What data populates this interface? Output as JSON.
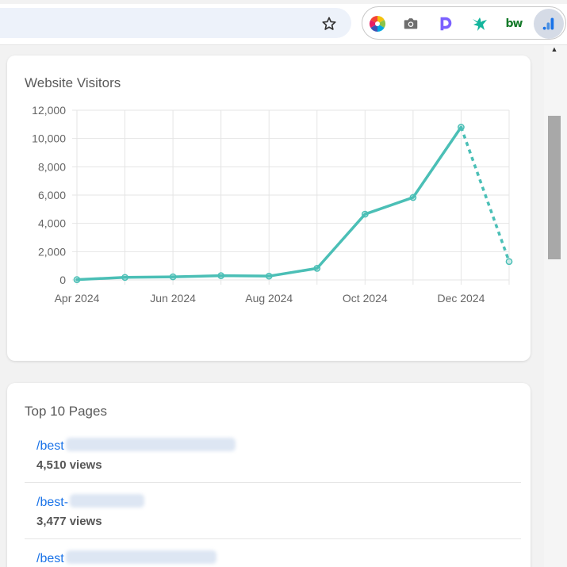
{
  "browser": {
    "extensions": [
      {
        "name": "color-wheel-icon"
      },
      {
        "name": "camera-icon"
      },
      {
        "name": "d-extension-icon"
      },
      {
        "name": "bird-extension-icon"
      },
      {
        "name": "bw-extension-icon",
        "label": "bw"
      },
      {
        "name": "analytics-extension-icon"
      }
    ]
  },
  "visitors_card": {
    "title": "Website Visitors"
  },
  "chart_data": {
    "type": "line",
    "title": "",
    "xlabel": "",
    "ylabel": "",
    "x_tick_labels": [
      "Apr 2024",
      "Jun 2024",
      "Aug 2024",
      "Oct 2024",
      "Dec 2024"
    ],
    "y_tick_labels": [
      "0",
      "2,000",
      "4,000",
      "6,000",
      "8,000",
      "10,000",
      "12,000"
    ],
    "ylim": [
      0,
      12000
    ],
    "grid": true,
    "x": [
      "2024-04",
      "2024-05",
      "2024-06",
      "2024-07",
      "2024-08",
      "2024-09",
      "2024-10",
      "2024-11",
      "2024-12",
      "2025-01"
    ],
    "series": [
      {
        "values": [
          20,
          180,
          220,
          300,
          270,
          820,
          4650,
          5830,
          10800,
          1300
        ],
        "color": "#4bbfb6",
        "projected_from_index": 8
      }
    ]
  },
  "pages_card": {
    "title": "Top 10 Pages",
    "rows": [
      {
        "path": "/best",
        "views": "4,510 views"
      },
      {
        "path": "/best-",
        "views": "3,477 views"
      },
      {
        "path": "/best",
        "views": ""
      }
    ]
  }
}
